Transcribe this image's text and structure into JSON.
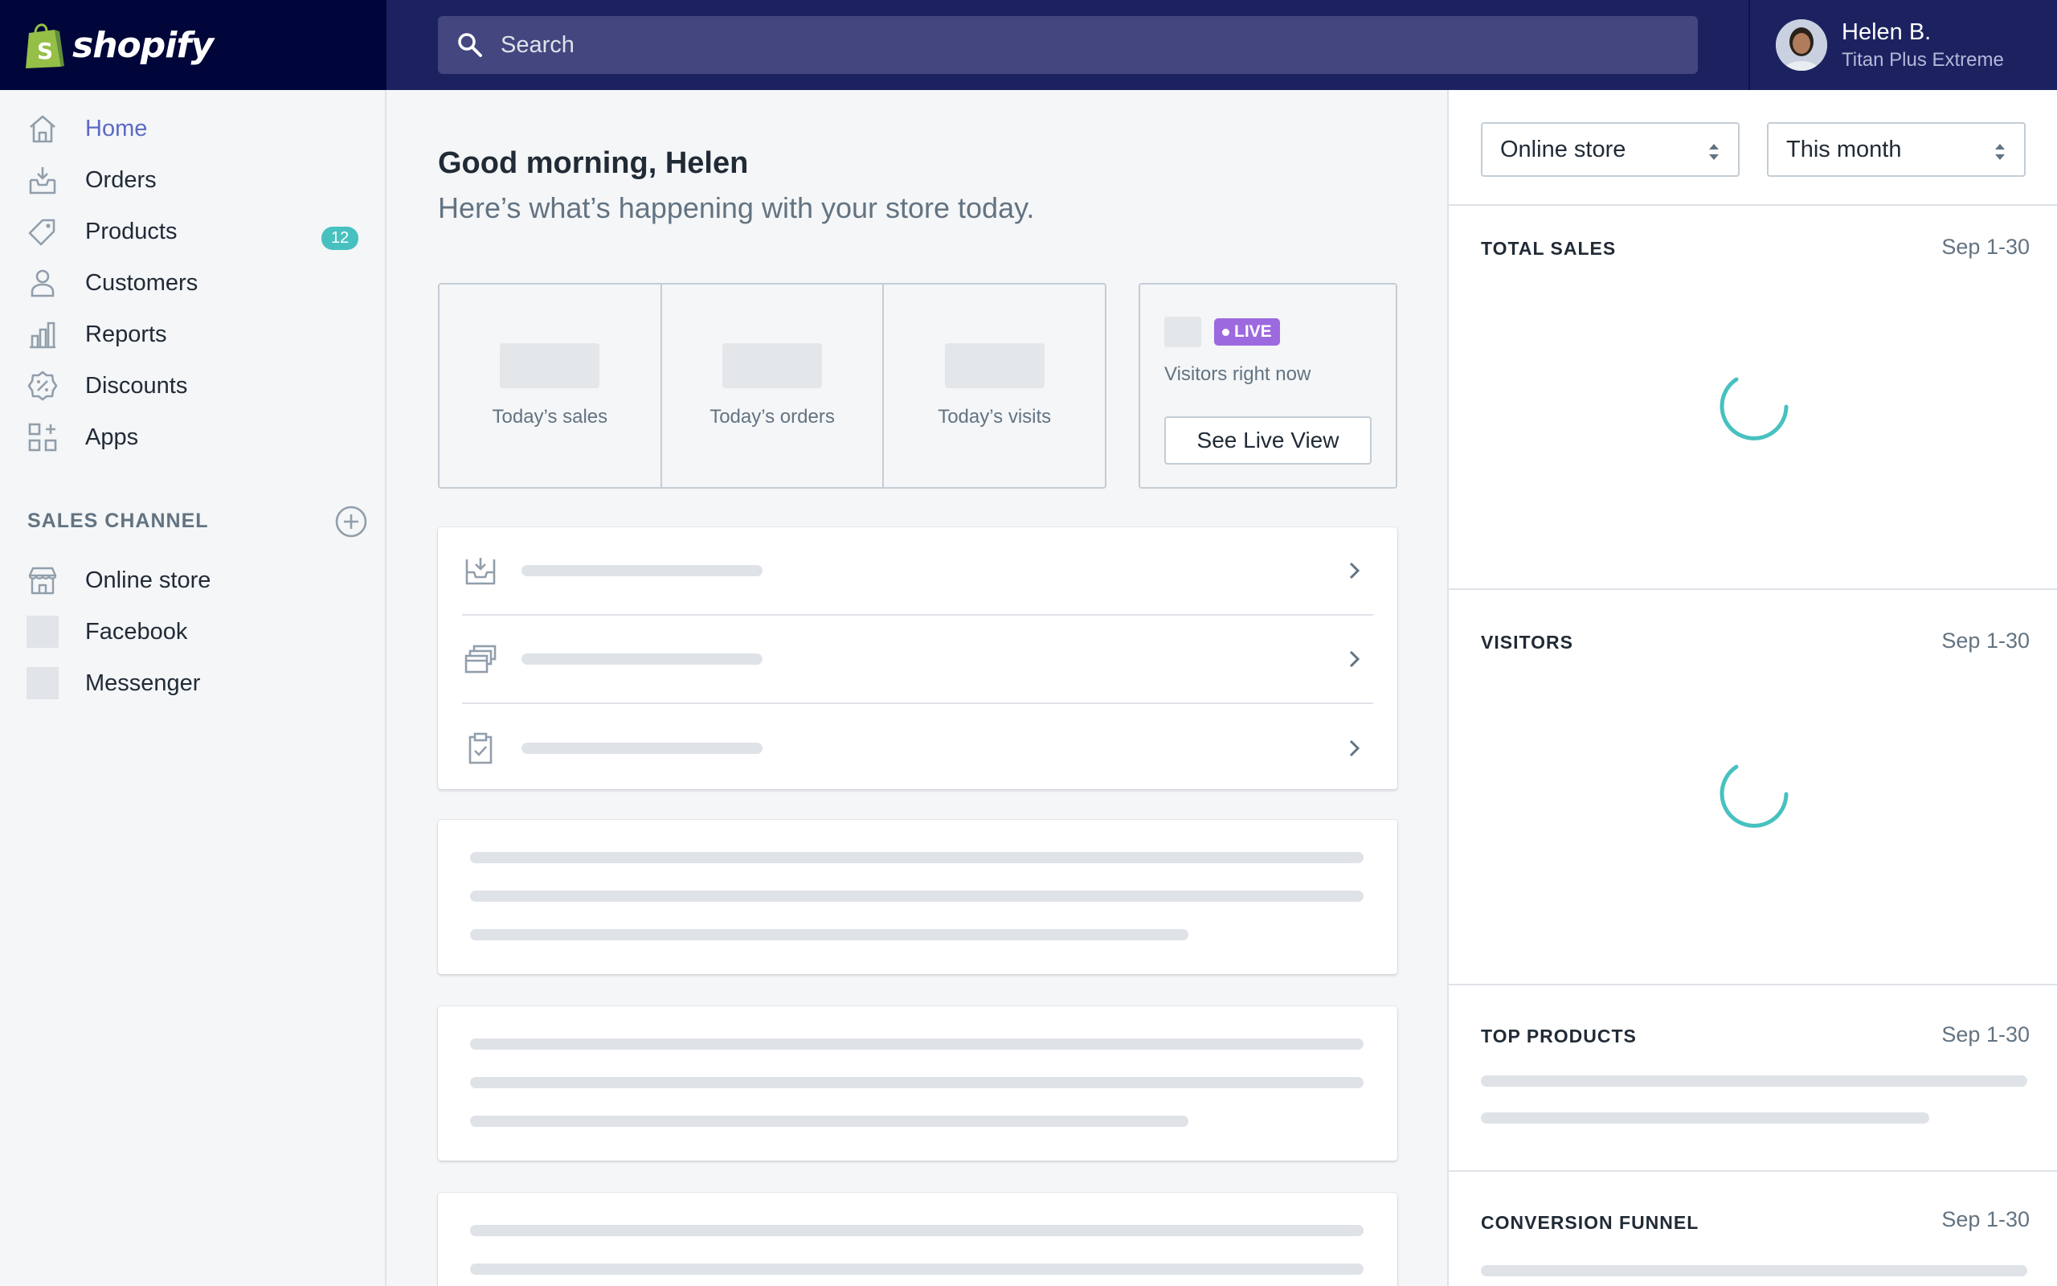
{
  "brand": {
    "name": "shopify"
  },
  "search": {
    "placeholder": "Search"
  },
  "user": {
    "name": "Helen B.",
    "store": "Titan Plus Extreme"
  },
  "sidebar": {
    "items": [
      {
        "label": "Home",
        "icon": "home-icon",
        "active": true
      },
      {
        "label": "Orders",
        "icon": "orders-icon"
      },
      {
        "label": "Products",
        "icon": "products-tag-icon",
        "badge": "12"
      },
      {
        "label": "Customers",
        "icon": "customers-icon"
      },
      {
        "label": "Reports",
        "icon": "reports-icon"
      },
      {
        "label": "Discounts",
        "icon": "discounts-icon"
      },
      {
        "label": "Apps",
        "icon": "apps-icon"
      }
    ],
    "section_title": "SALES CHANNEL",
    "channels": [
      {
        "label": "Online store",
        "icon": "online-store-icon"
      },
      {
        "label": "Facebook",
        "icon": "placeholder"
      },
      {
        "label": "Messenger",
        "icon": "placeholder"
      }
    ]
  },
  "main": {
    "greeting": "Good morning, Helen",
    "subgreeting": "Here’s what’s happening with your store today.",
    "stats": [
      "Today’s sales",
      "Today’s orders",
      "Today’s visits"
    ],
    "live": {
      "badge": "LIVE",
      "caption": "Visitors right now",
      "button": "See Live View"
    }
  },
  "right": {
    "channel_select": "Online store",
    "period_select": "This month",
    "sections": [
      {
        "title": "TOTAL SALES",
        "date": "Sep 1-30"
      },
      {
        "title": "VISITORS",
        "date": "Sep 1-30"
      },
      {
        "title": "TOP PRODUCTS",
        "date": "Sep 1-30"
      },
      {
        "title": "CONVERSION FUNNEL",
        "date": "Sep 1-30"
      }
    ]
  },
  "colors": {
    "topbar": "#1c2260",
    "logo_bg": "#000639",
    "accent": "#5c6ac4",
    "badge": "#47c1bf",
    "live": "#9c6ade",
    "spinner": "#47c1bf"
  }
}
